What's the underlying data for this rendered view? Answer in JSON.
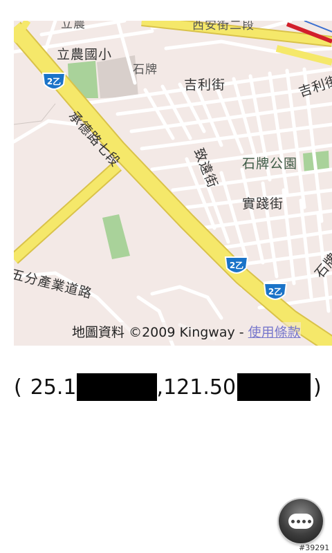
{
  "map": {
    "labels": {
      "top_clipped": "立農",
      "top_road_clipped": "西安街二段",
      "li_nong_school": "立農國小",
      "shi_pai_small": "石牌",
      "ji_li_street": "吉利街",
      "ji_li_street_right": "吉利街",
      "cheng_de_road": "承德路七段",
      "shi_pai_park": "石牌公園",
      "vertical_street": "致遠街",
      "shi_jian_street": "實踐街",
      "shi_pai_right": "石牌",
      "wufen_road": "五分產業道路"
    },
    "shield_label": "2乙",
    "attribution": {
      "data_label": "地圖資料",
      "copyright": "©2009 Kingway -",
      "terms": "使用條款"
    },
    "colors": {
      "background": "#f3e9e6",
      "major_road": "#f5e86a",
      "major_road_edge": "#d9c24a",
      "minor_road": "#ffffff",
      "park": "#a9d29a",
      "shield": "#1a73c8",
      "highway": "#d21f2b"
    }
  },
  "coordinates": {
    "open_paren": "(",
    "lat_prefix": "25.1",
    "separator": ",",
    "lng_prefix": "121.50",
    "close_paren": ")"
  },
  "menu_button": {
    "icon": "more-dots-icon"
  },
  "watermark": "#39291"
}
